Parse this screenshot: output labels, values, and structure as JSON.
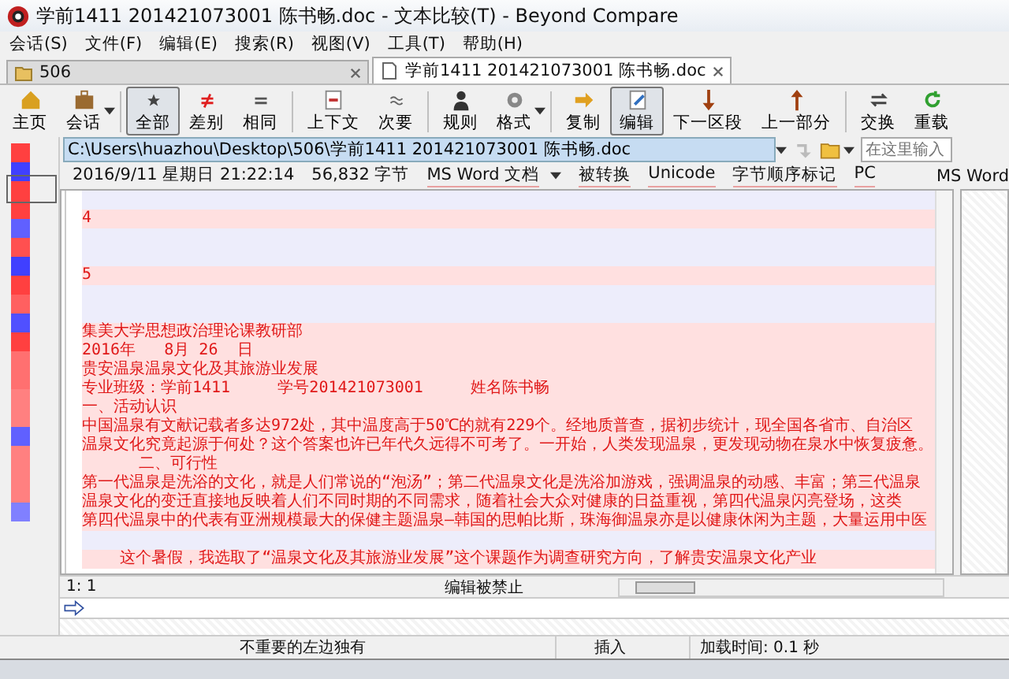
{
  "window": {
    "title": "学前1411 201421073001 陈书畅.doc - 文本比较(T) - Beyond Compare"
  },
  "menu": [
    "会话(S)",
    "文件(F)",
    "编辑(E)",
    "搜索(R)",
    "视图(V)",
    "工具(T)",
    "帮助(H)"
  ],
  "tabs": [
    {
      "label": "506",
      "selected": false
    },
    {
      "label": "学前1411  201421073001  陈书畅.doc",
      "selected": true
    }
  ],
  "toolbar": [
    {
      "label": "主页",
      "kind": "home",
      "selected": false,
      "dropdown": false
    },
    {
      "label": "会话",
      "kind": "session",
      "selected": false,
      "dropdown": true
    },
    {
      "label": "全部",
      "kind": "all",
      "selected": true,
      "dropdown": false
    },
    {
      "label": "差别",
      "kind": "diffs",
      "selected": false,
      "dropdown": false
    },
    {
      "label": "相同",
      "kind": "same",
      "selected": false,
      "dropdown": false
    },
    {
      "label": "上下文",
      "kind": "context",
      "selected": false,
      "dropdown": false
    },
    {
      "label": "次要",
      "kind": "minor",
      "selected": false,
      "dropdown": false
    },
    {
      "label": "规则",
      "kind": "rules",
      "selected": false,
      "dropdown": false
    },
    {
      "label": "格式",
      "kind": "format",
      "selected": false,
      "dropdown": true
    },
    {
      "label": "复制",
      "kind": "copy",
      "selected": false,
      "dropdown": false
    },
    {
      "label": "编辑",
      "kind": "edit",
      "selected": true,
      "dropdown": false
    },
    {
      "label": "下一区段",
      "kind": "next",
      "selected": false,
      "dropdown": false
    },
    {
      "label": "上一部分",
      "kind": "prev",
      "selected": false,
      "dropdown": false
    },
    {
      "label": "交换",
      "kind": "swap",
      "selected": false,
      "dropdown": false
    },
    {
      "label": "重载",
      "kind": "reload",
      "selected": false,
      "dropdown": false
    }
  ],
  "path": {
    "value": "C:\\Users\\huazhou\\Desktop\\506\\学前1411 201421073001 陈书畅.doc"
  },
  "search": {
    "placeholder": "在这里输入"
  },
  "file_info": {
    "date": "2016/9/11 星期日 21:22:14",
    "size": "56,832 字节",
    "format": "MS Word 文档",
    "tags": [
      "被转换",
      "Unicode",
      "字节顺序标记",
      "PC"
    ]
  },
  "right_pane": {
    "format": "MS Word"
  },
  "lines": [
    {
      "kind": "empty"
    },
    {
      "kind": "diff",
      "text": "4"
    },
    {
      "kind": "empty"
    },
    {
      "kind": "empty"
    },
    {
      "kind": "diff",
      "text": "5"
    },
    {
      "kind": "empty"
    },
    {
      "kind": "empty"
    },
    {
      "kind": "diff",
      "text": "集美大学思想政治理论课教研部"
    },
    {
      "kind": "diff",
      "text": "2016年   8月 26  日"
    },
    {
      "kind": "diff",
      "text": "贵安温泉温泉文化及其旅游业发展"
    },
    {
      "kind": "diff",
      "text": "专业班级：学前1411     学号201421073001     姓名陈书畅"
    },
    {
      "kind": "diff",
      "text": "一、活动认识"
    },
    {
      "kind": "diff",
      "text": "中国温泉有文献记载者多达972处，其中温度高于50℃的就有229个。经地质普查，据初步统计，现全国各省市、自治区"
    },
    {
      "kind": "diff",
      "text": "温泉文化究竟起源于何处？这个答案也许已年代久远得不可考了。一开始，人类发现温泉，更发现动物在泉水中恢复疲惫。"
    },
    {
      "kind": "diff",
      "text": "      二、可行性"
    },
    {
      "kind": "diff",
      "text": "第一代温泉是洗浴的文化，就是人们常说的“泡汤”；第二代温泉文化是洗浴加游戏，强调温泉的动感、丰富；第三代温泉"
    },
    {
      "kind": "diff",
      "text": "温泉文化的变迁直接地反映着人们不同时期的不同需求，随着社会大众对健康的日益重视，第四代温泉闪亮登场，这类"
    },
    {
      "kind": "diff",
      "text": "第四代温泉中的代表有亚洲规模最大的保健主题温泉—韩国的思帕比斯，珠海御温泉亦是以健康休闲为主题，大量运用中医"
    },
    {
      "kind": "empty"
    },
    {
      "kind": "diff",
      "text": "    这个暑假，我选取了“温泉文化及其旅游业发展”这个课题作为调查研究方向，了解贵安温泉文化产业"
    }
  ],
  "pane_status": {
    "position": "1: 1",
    "edit_state": "编辑被禁止"
  },
  "status_bar": {
    "message": "不重要的左边独有",
    "mode": "插入",
    "load_time": "加载时间: 0.1 秒"
  }
}
